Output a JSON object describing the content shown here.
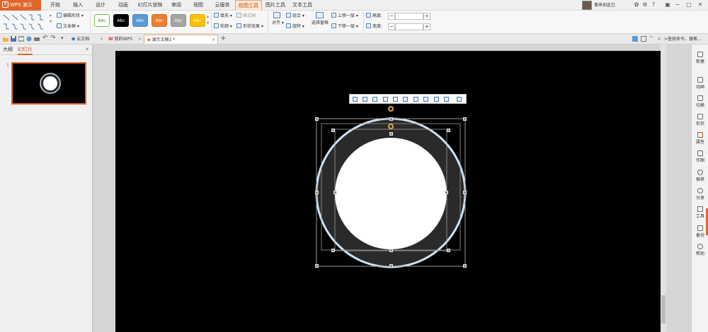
{
  "app": {
    "title": "WPS 演示",
    "logo": "P"
  },
  "menu": {
    "tabs": [
      {
        "label": "开始"
      },
      {
        "label": "插入"
      },
      {
        "label": "设计"
      },
      {
        "label": "动画"
      },
      {
        "label": "幻灯片放映"
      },
      {
        "label": "审阅"
      },
      {
        "label": "视图"
      },
      {
        "label": "云服务"
      },
      {
        "label": "绘图工具",
        "active": true
      },
      {
        "label": "图片工具"
      },
      {
        "label": "文本工具"
      }
    ]
  },
  "user": {
    "name": "事来如此已"
  },
  "ribbon": {
    "edit_shape": "编辑形状",
    "text_box": "文本框",
    "styles": [
      {
        "label": "Abc",
        "bg": "#ffffff",
        "fg": "#3a8a3a",
        "border": "#6cbf4a"
      },
      {
        "label": "Abc",
        "bg": "#000000",
        "fg": "#ffffff",
        "border": "#000000"
      },
      {
        "label": "Abc",
        "bg": "#5b9bd5",
        "fg": "#ffffff",
        "border": "#4a86c0"
      },
      {
        "label": "Abc",
        "bg": "#ed7d31",
        "fg": "#ffffff",
        "border": "#d46a22"
      },
      {
        "label": "Abc",
        "bg": "#a5a5a5",
        "fg": "#ffffff",
        "border": "#8d8d8d"
      },
      {
        "label": "Abc",
        "bg": "#ffc000",
        "fg": "#ffffff",
        "border": "#e0a800"
      }
    ],
    "fill": "填充",
    "format_painter": "格式刷",
    "outline": "轮廓",
    "shape_effects": "形状效果",
    "align": "对齐",
    "group": "组合",
    "rotate": "旋转",
    "selection_pane": "选择窗格",
    "bring_forward": "上移一层",
    "send_backward": "下移一层",
    "height_label": "高度:",
    "width_label": "宽度:",
    "height_value": "",
    "width_value": ""
  },
  "quickbar": {
    "tabs": [
      {
        "label": "云文档",
        "active": false
      },
      {
        "label": "我的WPS",
        "active": false
      },
      {
        "label": "演示文稿1 *",
        "active": true
      }
    ],
    "search_placeholder": ">查找命令、搜索..."
  },
  "left_panel": {
    "tabs": [
      {
        "label": "大纲"
      },
      {
        "label": "幻灯片",
        "active": true
      }
    ],
    "slide_number": "1"
  },
  "right_sidebar": {
    "items": [
      {
        "label": "新建",
        "icon": "new-icon"
      },
      {
        "label": "动画",
        "icon": "animation-icon"
      },
      {
        "label": "切换",
        "icon": "transition-icon"
      },
      {
        "label": "形状",
        "icon": "shapes-icon"
      },
      {
        "label": "属性",
        "icon": "properties-icon"
      },
      {
        "label": "作图",
        "icon": "draw-icon"
      },
      {
        "label": "推荐",
        "icon": "recommend-icon"
      },
      {
        "label": "分享",
        "icon": "share-icon"
      },
      {
        "label": "工具",
        "icon": "toolbox-icon"
      },
      {
        "label": "备份",
        "icon": "backup-icon"
      },
      {
        "label": "帮助",
        "icon": "help-icon"
      }
    ]
  },
  "colors": {
    "accent": "#e0662a",
    "slide_bg": "#000000",
    "ring": "#2a2a2a",
    "ring_outline": "#cfe3f5"
  }
}
